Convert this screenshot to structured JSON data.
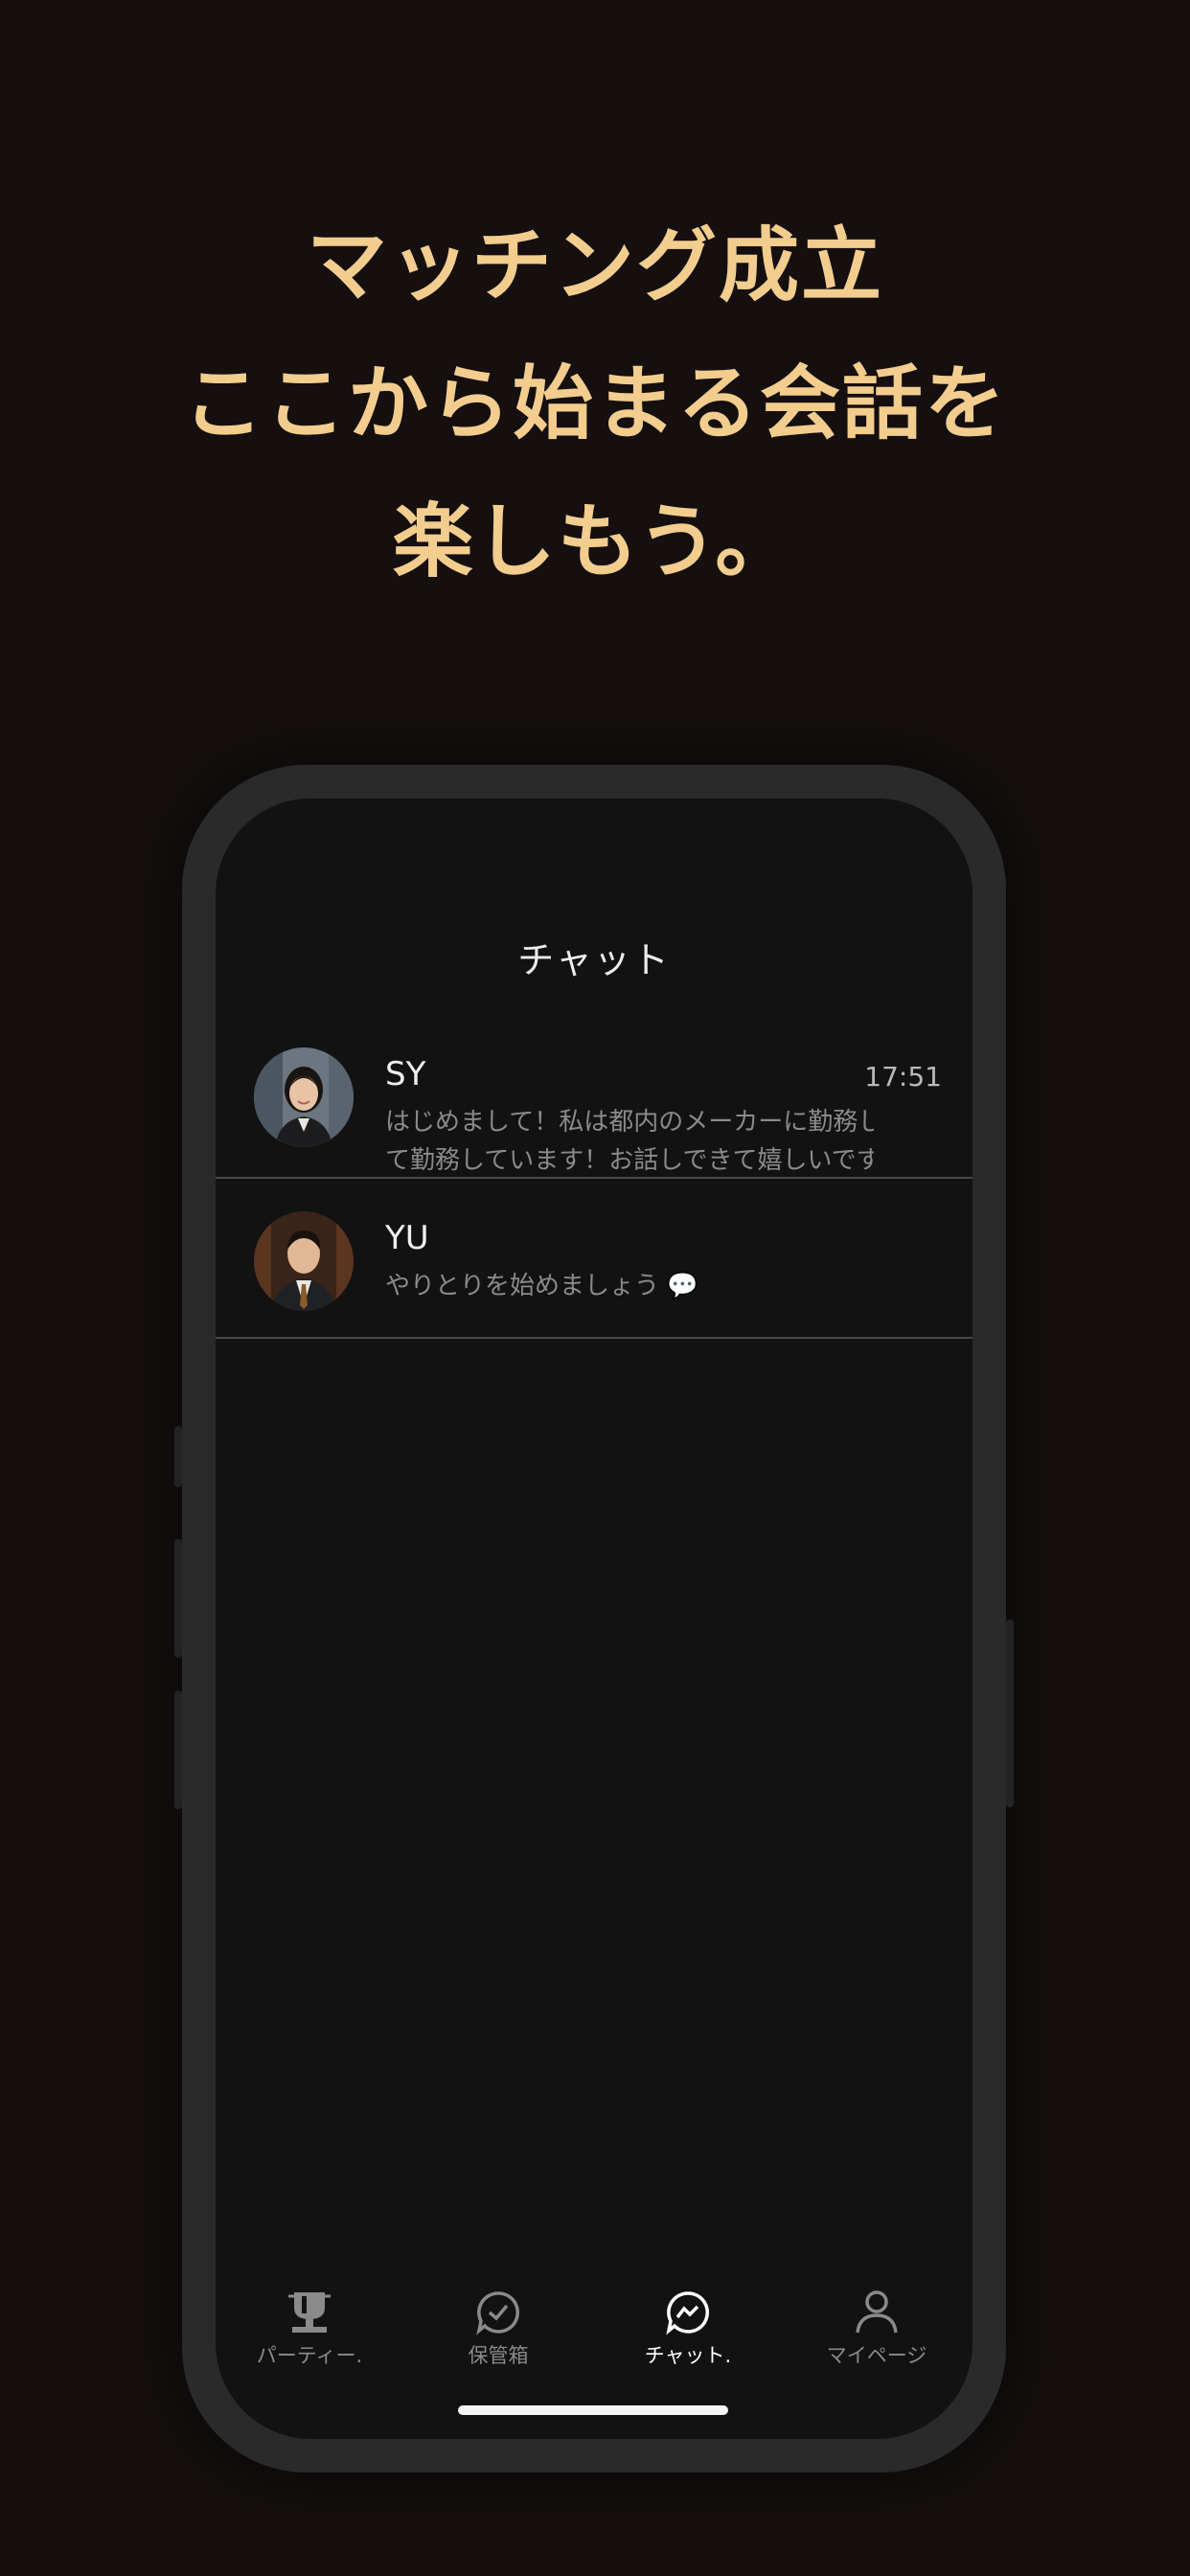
{
  "headline": {
    "line1": "マッチング成立",
    "line2": "ここから始まる会話を",
    "line3": "楽しもう。"
  },
  "screen": {
    "title": "チャット",
    "chats": [
      {
        "name": "SY",
        "time": "17:51",
        "preview_line1": "はじめまして！私は都内のメーカーに勤務し",
        "preview_line2": "て勤務しています！お話しできて嬉しいです",
        "avatar": "woman-portrait-avatar"
      },
      {
        "name": "YU",
        "preview_line1": "やりとりを始めましょう 💬",
        "avatar": "man-portrait-avatar"
      }
    ],
    "tabs": [
      {
        "label": "パーティー.",
        "icon": "trophy-icon",
        "active": false
      },
      {
        "label": "保管箱",
        "icon": "check-bubble-icon",
        "active": false
      },
      {
        "label": "チャット.",
        "icon": "messenger-icon",
        "active": true
      },
      {
        "label": "マイページ",
        "icon": "person-icon",
        "active": false
      }
    ]
  },
  "colors": {
    "headline": "#f2cd8e",
    "background": "#150f0f",
    "screen": "#121212",
    "tab_active": "#ffffff",
    "tab_inactive": "#8a8a8a"
  }
}
